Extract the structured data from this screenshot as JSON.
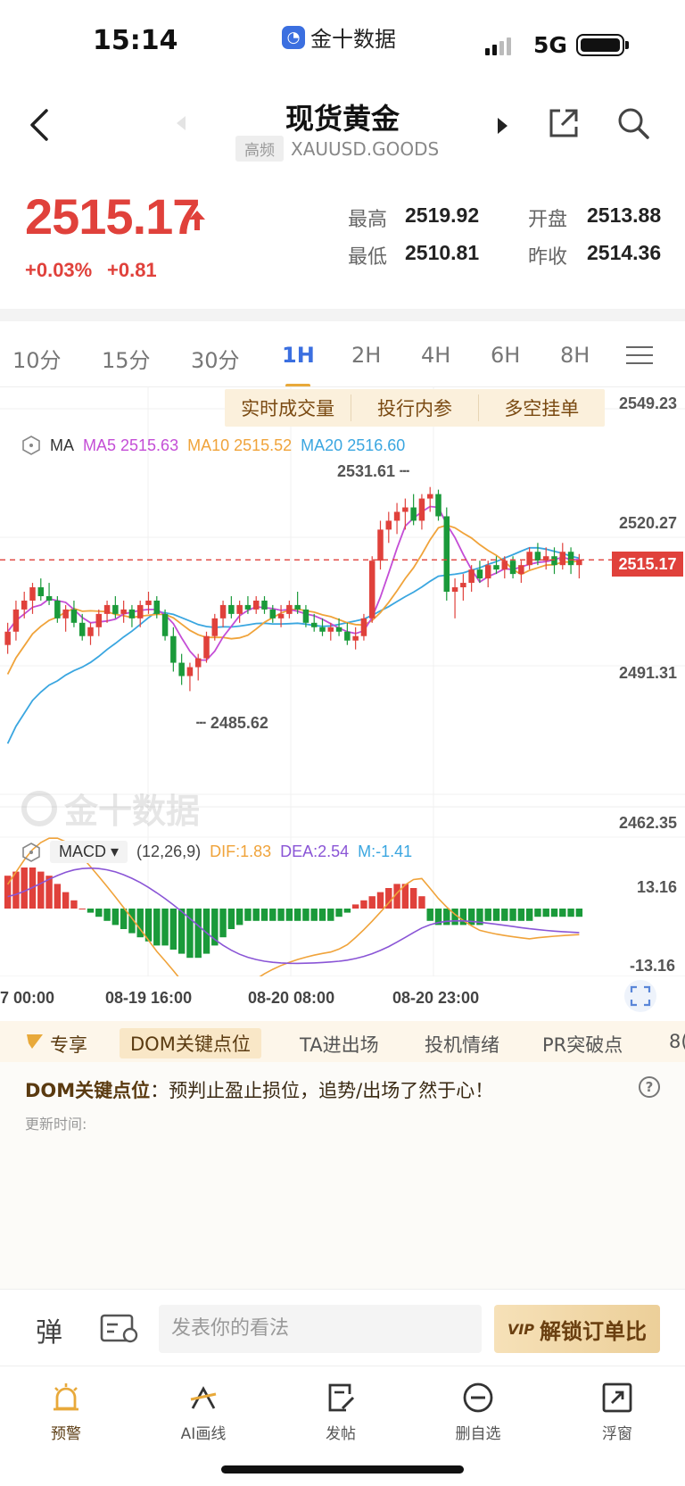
{
  "status": {
    "time": "15:14",
    "app_name": "金十数据",
    "network": "5G"
  },
  "header": {
    "title": "现货黄金",
    "badge": "高频",
    "symbol": "XAUUSD.GOODS"
  },
  "quote": {
    "price": "2515.17",
    "change_pct": "+0.03%",
    "change": "+0.81",
    "high_label": "最高",
    "high": "2519.92",
    "low_label": "最低",
    "low": "2510.81",
    "open_label": "开盘",
    "open": "2513.88",
    "prev_label": "昨收",
    "prev_close": "2514.36"
  },
  "periods": [
    "10分",
    "15分",
    "30分",
    "1H",
    "2H",
    "4H",
    "6H",
    "8H"
  ],
  "active_period": "1H",
  "promo": [
    "实时成交量",
    "投行内参",
    "多空挂单"
  ],
  "ma": {
    "label": "MA",
    "ma5": "MA5 2515.63",
    "ma10": "MA10 2515.52",
    "ma20": "MA20 2516.60",
    "ma5_color": "#c44dd6",
    "ma10_color": "#f0a33a",
    "ma20_color": "#3aa6e0"
  },
  "macd": {
    "indicator": "MACD",
    "params": "(12,26,9)",
    "dif": "DIF:1.83",
    "dea": "DEA:2.54",
    "m": "M:-1.41",
    "y_top": "13.16",
    "y_bottom": "-13.16"
  },
  "y_axis": [
    "2549.23",
    "2520.27",
    "2491.31",
    "2462.35"
  ],
  "current_price_tag": "2515.17",
  "high_marker": "2531.61",
  "low_marker": "2485.62",
  "x_axis": [
    "7 00:00",
    "08-19 16:00",
    "08-20 08:00",
    "08-20 23:00"
  ],
  "watermark": "金十数据",
  "feature_tabs": [
    "专享",
    "DOM关键点位",
    "TA进出场",
    "投机情绪",
    "PR突破点",
    "8("
  ],
  "info": {
    "title": "DOM关键点位",
    "text": "：预判止盈止损位，追势/出场了然于心！",
    "updated": "更新时间:"
  },
  "comment": {
    "danmu": "弹",
    "placeholder": "发表你的看法",
    "unlock": "解锁订单比",
    "vip": "VIP"
  },
  "nav": [
    {
      "label": "预警",
      "icon": "alarm-icon"
    },
    {
      "label": "AI画线",
      "icon": "ai-draw-icon"
    },
    {
      "label": "发帖",
      "icon": "post-icon"
    },
    {
      "label": "删自选",
      "icon": "remove-watchlist-icon"
    },
    {
      "label": "浮窗",
      "icon": "float-window-icon"
    }
  ],
  "colors": {
    "up": "#e0413b",
    "down": "#1a9a3a",
    "accent": "#3b6fe0",
    "gold": "#e8a93a"
  },
  "chart_data": {
    "type": "candlestick",
    "interval": "1H",
    "ylim": [
      2462.35,
      2549.23
    ],
    "y_ticks": [
      2549.23,
      2520.27,
      2491.31,
      2462.35
    ],
    "last_price": 2515.17,
    "high": 2531.61,
    "low": 2485.62,
    "ohlc": [
      [
        2496,
        2501,
        2494,
        2499
      ],
      [
        2499,
        2506,
        2497,
        2504
      ],
      [
        2504,
        2508,
        2502,
        2506
      ],
      [
        2506,
        2510,
        2503,
        2509
      ],
      [
        2509,
        2511,
        2506,
        2507
      ],
      [
        2507,
        2510,
        2505,
        2506
      ],
      [
        2506,
        2507,
        2501,
        2502
      ],
      [
        2502,
        2505,
        2499,
        2504
      ],
      [
        2504,
        2506,
        2500,
        2501
      ],
      [
        2501,
        2503,
        2497,
        2498
      ],
      [
        2498,
        2501,
        2496,
        2500
      ],
      [
        2500,
        2504,
        2498,
        2503
      ],
      [
        2503,
        2506,
        2501,
        2505
      ],
      [
        2505,
        2507,
        2502,
        2503
      ],
      [
        2503,
        2506,
        2501,
        2504
      ],
      [
        2504,
        2505,
        2500,
        2502
      ],
      [
        2502,
        2506,
        2500,
        2505
      ],
      [
        2505,
        2508,
        2503,
        2506
      ],
      [
        2506,
        2507,
        2502,
        2503
      ],
      [
        2503,
        2504,
        2497,
        2498
      ],
      [
        2498,
        2500,
        2490,
        2492
      ],
      [
        2492,
        2494,
        2487,
        2489
      ],
      [
        2489,
        2492,
        2485.6,
        2491
      ],
      [
        2491,
        2494,
        2488,
        2493
      ],
      [
        2493,
        2499,
        2492,
        2498
      ],
      [
        2498,
        2503,
        2497,
        2502
      ],
      [
        2502,
        2506,
        2500,
        2505
      ],
      [
        2505,
        2507,
        2502,
        2503
      ],
      [
        2503,
        2506,
        2501,
        2505
      ],
      [
        2505,
        2507,
        2503,
        2504
      ],
      [
        2504,
        2507,
        2503,
        2506
      ],
      [
        2506,
        2507,
        2503,
        2504
      ],
      [
        2504,
        2505,
        2501,
        2502
      ],
      [
        2502,
        2505,
        2500,
        2503
      ],
      [
        2503,
        2506,
        2502,
        2505
      ],
      [
        2505,
        2508,
        2503,
        2504
      ],
      [
        2504,
        2505,
        2500,
        2501
      ],
      [
        2501,
        2503,
        2499,
        2500
      ],
      [
        2500,
        2502,
        2498,
        2499
      ],
      [
        2499,
        2501,
        2497,
        2500
      ],
      [
        2500,
        2502,
        2498,
        2499
      ],
      [
        2499,
        2501,
        2496,
        2497
      ],
      [
        2497,
        2500,
        2495,
        2498
      ],
      [
        2498,
        2503,
        2497,
        2502
      ],
      [
        2502,
        2516,
        2501,
        2515
      ],
      [
        2515,
        2524,
        2513,
        2522
      ],
      [
        2522,
        2526,
        2519,
        2524
      ],
      [
        2524,
        2528,
        2521,
        2526
      ],
      [
        2526,
        2529,
        2522,
        2527
      ],
      [
        2527,
        2530,
        2523,
        2524
      ],
      [
        2524,
        2530,
        2522,
        2529
      ],
      [
        2529,
        2531.6,
        2526,
        2530
      ],
      [
        2530,
        2531,
        2524,
        2525
      ],
      [
        2525,
        2527,
        2506,
        2508
      ],
      [
        2508,
        2511,
        2502,
        2509
      ],
      [
        2509,
        2512,
        2506,
        2510
      ],
      [
        2510,
        2514,
        2508,
        2513
      ],
      [
        2513,
        2515,
        2510,
        2511
      ],
      [
        2511,
        2515,
        2509,
        2514
      ],
      [
        2514,
        2516,
        2512,
        2513
      ],
      [
        2513,
        2516,
        2511,
        2515
      ],
      [
        2515,
        2516,
        2511,
        2512
      ],
      [
        2512,
        2515,
        2510,
        2514
      ],
      [
        2514,
        2518,
        2513,
        2517
      ],
      [
        2517,
        2519,
        2514,
        2515
      ],
      [
        2515,
        2518,
        2513,
        2516
      ],
      [
        2516,
        2518,
        2512,
        2514
      ],
      [
        2514,
        2519,
        2513,
        2517
      ],
      [
        2517,
        2518,
        2512,
        2514
      ],
      [
        2514,
        2516.5,
        2511,
        2515.17
      ]
    ],
    "macd_hist": [
      8,
      9,
      10,
      10,
      9,
      8,
      6,
      4,
      2,
      0,
      -1,
      -2,
      -3,
      -4,
      -5,
      -6,
      -7,
      -8,
      -9,
      -9,
      -10,
      -11,
      -12,
      -12,
      -11,
      -9,
      -7,
      -5,
      -4,
      -3,
      -3,
      -3,
      -3,
      -3,
      -3,
      -3,
      -3,
      -3,
      -3,
      -3,
      -2,
      -1,
      1,
      2,
      3,
      4,
      5,
      6,
      6,
      5,
      3,
      -3,
      -4,
      -4,
      -4,
      -4,
      -4,
      -4,
      -3,
      -3,
      -3,
      -3,
      -3,
      -3,
      -2,
      -2,
      -2,
      -2,
      -2,
      -2
    ]
  }
}
